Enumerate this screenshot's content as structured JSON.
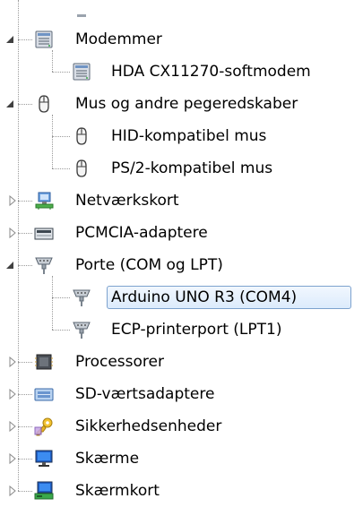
{
  "tree": {
    "items": [
      {
        "label": "",
        "level": 1,
        "icon": "partial-item-icon",
        "state": "clipped"
      },
      {
        "label": "Modemmer",
        "level": 0,
        "icon": "modem-icon",
        "state": "expanded"
      },
      {
        "label": "HDA CX11270-softmodem",
        "level": 1,
        "icon": "modem-icon",
        "state": "leaf"
      },
      {
        "label": "Mus og andre pegeredskaber",
        "level": 0,
        "icon": "mouse-icon",
        "state": "expanded"
      },
      {
        "label": "HID-kompatibel mus",
        "level": 1,
        "icon": "mouse-icon",
        "state": "leaf"
      },
      {
        "label": "PS/2-kompatibel mus",
        "level": 1,
        "icon": "mouse-icon",
        "state": "leaf"
      },
      {
        "label": "Netværkskort",
        "level": 0,
        "icon": "network-adapter-icon",
        "state": "collapsed"
      },
      {
        "label": "PCMCIA-adaptere",
        "level": 0,
        "icon": "pcmcia-icon",
        "state": "collapsed"
      },
      {
        "label": "Porte (COM og LPT)",
        "level": 0,
        "icon": "port-connector-icon",
        "state": "expanded"
      },
      {
        "label": "Arduino UNO R3 (COM4)",
        "level": 1,
        "icon": "port-connector-icon",
        "state": "leaf",
        "selected": true
      },
      {
        "label": "ECP-printerport (LPT1)",
        "level": 1,
        "icon": "port-connector-icon",
        "state": "leaf"
      },
      {
        "label": "Processorer",
        "level": 0,
        "icon": "processor-icon",
        "state": "collapsed"
      },
      {
        "label": "SD-værtsadaptere",
        "level": 0,
        "icon": "sd-host-icon",
        "state": "collapsed"
      },
      {
        "label": "Sikkerhedsenheder",
        "level": 0,
        "icon": "security-key-icon",
        "state": "collapsed"
      },
      {
        "label": "Skærme",
        "level": 0,
        "icon": "monitor-icon",
        "state": "collapsed"
      },
      {
        "label": "Skærmkort",
        "level": 0,
        "icon": "display-adapter-icon",
        "state": "collapsed"
      }
    ]
  },
  "colors": {
    "selection_border": "#7da2ce",
    "selection_fill": "#dcebfc",
    "tree_lines": "#9a9a9a"
  }
}
